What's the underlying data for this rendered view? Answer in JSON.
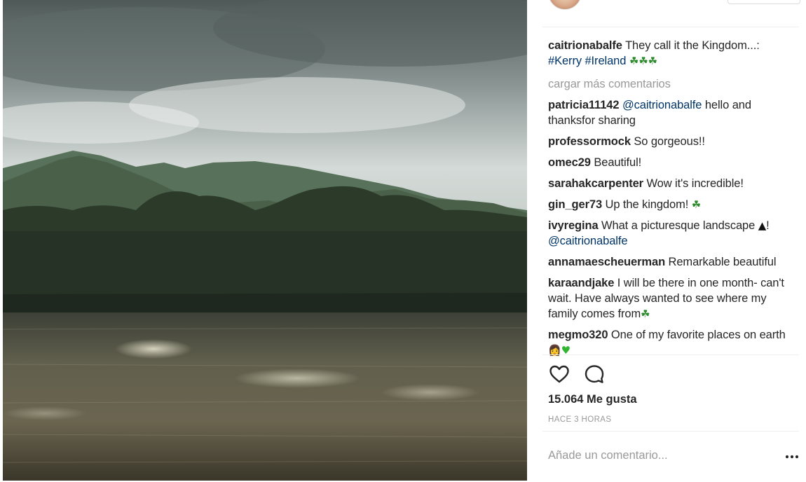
{
  "post": {
    "caption": {
      "user": "caitrionabalfe",
      "text": " They call it the Kingdom...: ",
      "tags": [
        "#Kerry",
        "#Ireland"
      ],
      "emoji": " ☘☘☘"
    },
    "load_more": "cargar más comentarios",
    "comments": [
      {
        "user": "patricia11142",
        "mention": "@caitrionabalfe",
        "text": " hello and thanksfor sharing"
      },
      {
        "user": "professormock",
        "text": " So gorgeous!!"
      },
      {
        "user": "omec29",
        "text": " Beautiful!"
      },
      {
        "user": "sarahakcarpenter",
        "text": " Wow it's incredible!"
      },
      {
        "user": "gin_ger73",
        "text": " Up the kingdom! ",
        "emoji": "☘"
      },
      {
        "user": "ivyregina",
        "text": " What a picturesque landscape ",
        "emoji": "▲",
        "text2": "!",
        "mention2": "@caitrionabalfe"
      },
      {
        "user": "annamaescheuerman",
        "text": " Remarkable beautiful"
      },
      {
        "user": "karaandjake",
        "text": " I will be there in one month- can't wait. Have always wanted to see where my family comes from",
        "emoji": "☘"
      },
      {
        "user": "megmo320",
        "text": " One of my favorite places on earth ",
        "emoji": "👩",
        "emoji2": "♥"
      }
    ],
    "likes": "15.064 Me gusta",
    "time": "HACE 3 HORAS",
    "add_comment_placeholder": "Añade un comentario...",
    "icons": {
      "like": "heart-outline-icon",
      "comment": "comment-bubble-icon",
      "more": "more-options-icon"
    },
    "colors": {
      "link": "#003569",
      "muted": "#999999",
      "text": "#262626"
    }
  }
}
